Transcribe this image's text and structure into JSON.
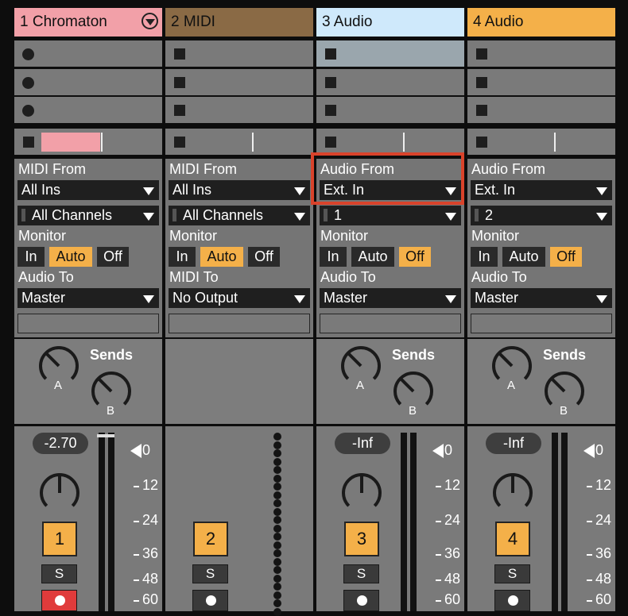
{
  "tracks": [
    {
      "name": "1 Chromaton",
      "type": "midi",
      "header_color": "#f2a0a8",
      "in_label": "MIDI From",
      "in_source": "All Ins",
      "in_channel": "All Channels",
      "monitor_label": "Monitor",
      "monitor": [
        "In",
        "Auto",
        "Off"
      ],
      "monitor_selected": "Auto",
      "out_label": "Audio To",
      "out_target": "Master",
      "sends_label": "Sends",
      "send_a": "A",
      "send_b": "B",
      "volume": "-2.70",
      "number": "1",
      "solo": "S",
      "armed": true
    },
    {
      "name": "2 MIDI",
      "type": "midi",
      "header_color": "#8a6a45",
      "in_label": "MIDI From",
      "in_source": "All Ins",
      "in_channel": "All Channels",
      "monitor_label": "Monitor",
      "monitor": [
        "In",
        "Auto",
        "Off"
      ],
      "monitor_selected": "Auto",
      "out_label": "MIDI To",
      "out_target": "No Output",
      "number": "2",
      "solo": "S",
      "armed": false
    },
    {
      "name": "3 Audio",
      "type": "audio",
      "header_color": "#cfe9fb",
      "in_label": "Audio From",
      "in_source": "Ext. In",
      "in_channel": "1",
      "monitor_label": "Monitor",
      "monitor": [
        "In",
        "Auto",
        "Off"
      ],
      "monitor_selected": "Off",
      "out_label": "Audio To",
      "out_target": "Master",
      "sends_label": "Sends",
      "send_a": "A",
      "send_b": "B",
      "volume": "-Inf",
      "number": "3",
      "solo": "S",
      "armed": false
    },
    {
      "name": "4 Audio",
      "type": "audio",
      "header_color": "#f4b049",
      "in_label": "Audio From",
      "in_source": "Ext. In",
      "in_channel": "2",
      "monitor_label": "Monitor",
      "monitor": [
        "In",
        "Auto",
        "Off"
      ],
      "monitor_selected": "Off",
      "out_label": "Audio To",
      "out_target": "Master",
      "sends_label": "Sends",
      "send_a": "A",
      "send_b": "B",
      "volume": "-Inf",
      "number": "4",
      "solo": "S",
      "armed": false
    }
  ],
  "meter_scale": [
    "0",
    "12",
    "24",
    "36",
    "48",
    "60"
  ],
  "colors": {
    "accent": "#f4b049",
    "highlight_box": "#d9432b",
    "record_arm": "#e03b3b"
  }
}
